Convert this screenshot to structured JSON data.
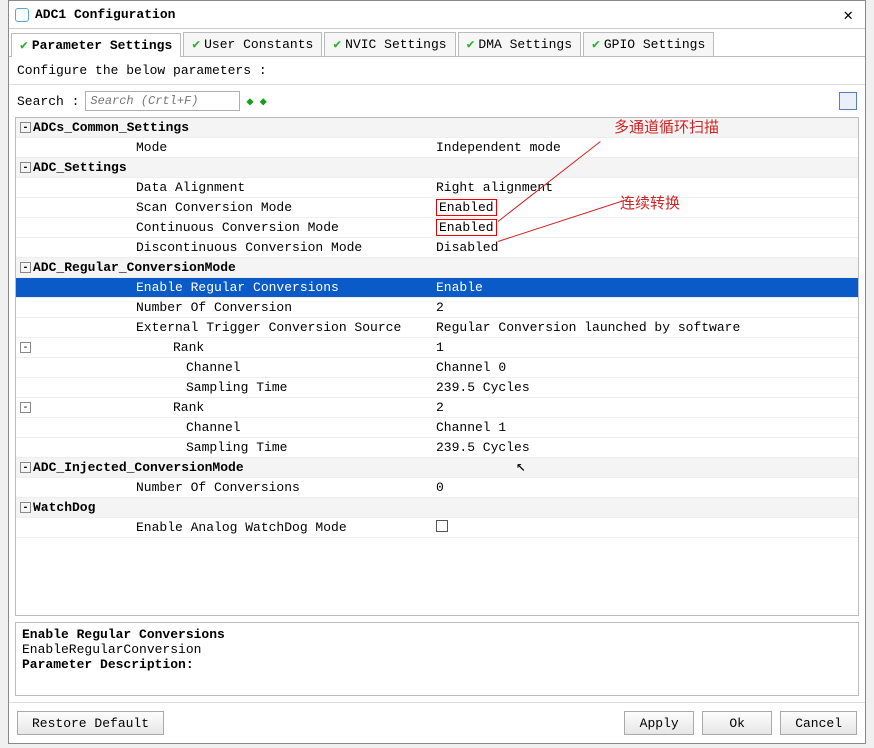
{
  "window": {
    "title": "ADC1 Configuration"
  },
  "tabs": [
    {
      "label": "Parameter Settings"
    },
    {
      "label": "User Constants"
    },
    {
      "label": "NVIC Settings"
    },
    {
      "label": "DMA Settings"
    },
    {
      "label": "GPIO Settings"
    }
  ],
  "subtitle": "Configure the below parameters :",
  "search": {
    "label": "Search :",
    "placeholder": "Search (Crtl+F)"
  },
  "groups": {
    "g0": {
      "name": "ADCs_Common_Settings"
    },
    "g1": {
      "name": "ADC_Settings"
    },
    "g2": {
      "name": "ADC_Regular_ConversionMode"
    },
    "g3": {
      "name": "ADC_Injected_ConversionMode"
    },
    "g4": {
      "name": "WatchDog"
    }
  },
  "params": {
    "mode": {
      "label": "Mode",
      "value": "Independent mode"
    },
    "align": {
      "label": "Data Alignment",
      "value": "Right alignment"
    },
    "scan": {
      "label": "Scan Conversion Mode",
      "value": "Enabled"
    },
    "cont": {
      "label": "Continuous Conversion Mode",
      "value": "Enabled"
    },
    "disc": {
      "label": "Discontinuous Conversion Mode",
      "value": "Disabled"
    },
    "enreg": {
      "label": "Enable Regular Conversions",
      "value": "Enable"
    },
    "numconv": {
      "label": "Number Of Conversion",
      "value": "2"
    },
    "exttrig": {
      "label": "External Trigger Conversion Source",
      "value": "Regular Conversion launched by software"
    },
    "rank1": {
      "label": "Rank",
      "value": "1"
    },
    "r1ch": {
      "label": "Channel",
      "value": "Channel 0"
    },
    "r1samp": {
      "label": "Sampling Time",
      "value": "239.5 Cycles"
    },
    "rank2": {
      "label": "Rank",
      "value": "2"
    },
    "r2ch": {
      "label": "Channel",
      "value": "Channel 1"
    },
    "r2samp": {
      "label": "Sampling Time",
      "value": "239.5 Cycles"
    },
    "numinj": {
      "label": "Number Of Conversions",
      "value": "0"
    },
    "wdog": {
      "label": "Enable Analog WatchDog Mode"
    }
  },
  "annotations": {
    "a1": "多通道循环扫描",
    "a2": "连续转换"
  },
  "desc": {
    "l1": "Enable Regular Conversions",
    "l2": "EnableRegularConversion",
    "l3": "Parameter Description:"
  },
  "buttons": {
    "restore": "Restore Default",
    "apply": "Apply",
    "ok": "Ok",
    "cancel": "Cancel"
  }
}
